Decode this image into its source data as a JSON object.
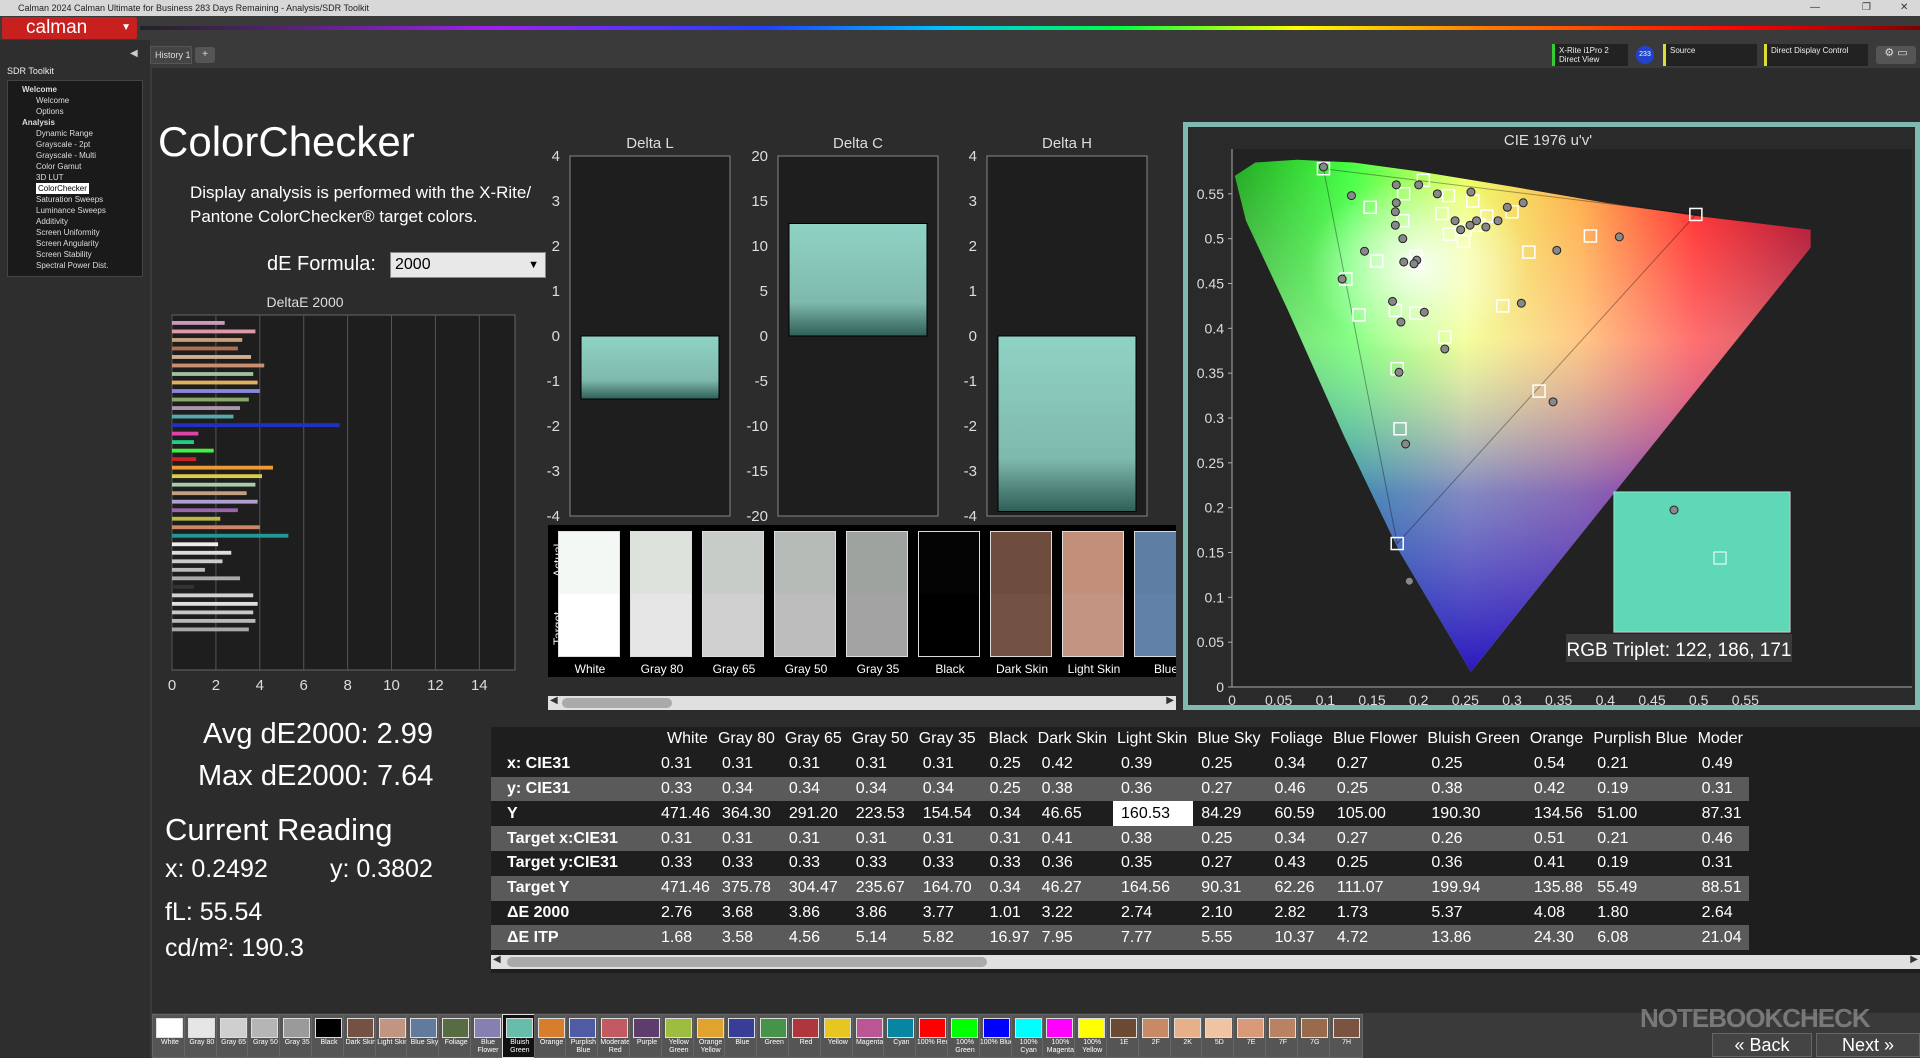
{
  "window": {
    "title": "Calman 2024 Calman Ultimate for Business 283 Days Remaining - Analysis/SDR Toolkit"
  },
  "logo": {
    "text": "calman"
  },
  "sidebar": {
    "title": "SDR Toolkit",
    "items": [
      {
        "label": "Welcome",
        "level": "group"
      },
      {
        "label": "Welcome",
        "level": "item"
      },
      {
        "label": "Options",
        "level": "item"
      },
      {
        "label": "Analysis",
        "level": "group"
      },
      {
        "label": "Dynamic Range",
        "level": "item"
      },
      {
        "label": "Grayscale - 2pt",
        "level": "item"
      },
      {
        "label": "Grayscale - Multi",
        "level": "item"
      },
      {
        "label": "Color Gamut",
        "level": "item"
      },
      {
        "label": "3D LUT",
        "level": "item"
      },
      {
        "label": "ColorChecker",
        "level": "item",
        "selected": true
      },
      {
        "label": "Saturation Sweeps",
        "level": "item"
      },
      {
        "label": "Luminance Sweeps",
        "level": "item"
      },
      {
        "label": "Additivity",
        "level": "item"
      },
      {
        "label": "Screen Uniformity",
        "level": "item"
      },
      {
        "label": "Screen Angularity",
        "level": "item"
      },
      {
        "label": "Screen Stability",
        "level": "item"
      },
      {
        "label": "Spectral Power Dist.",
        "level": "item"
      }
    ]
  },
  "tabs": {
    "history": "History 1",
    "add": "+"
  },
  "devices": {
    "meter_line1": "X-Rite i1Pro 2",
    "meter_line2": "Direct View",
    "meter_badge": "233",
    "source": "Source",
    "display": "Direct Display Control"
  },
  "page": {
    "title": "ColorChecker",
    "description": "Display analysis is performed with the X-Rite/ Pantone ColorChecker® target colors.",
    "de_formula_label": "dE Formula:",
    "de_formula_value": "2000"
  },
  "stats": {
    "avg": "Avg dE2000: 2.99",
    "max": "Max dE2000: 7.64",
    "current_title": "Current Reading",
    "x": "x: 0.2492",
    "y": "y: 0.3802",
    "fl": "fL: 55.54",
    "cdm2": "cd/m²: 190.3"
  },
  "colors": {
    "accent": "#7fb9b0",
    "bar_top": "#8fd3c5",
    "bar_bottom": "#2f5f58",
    "table_alt": "#5a5a5a"
  },
  "chart_data": [
    {
      "type": "bar",
      "title": "DeltaE 2000",
      "orientation": "horizontal",
      "xlim": [
        0,
        15
      ],
      "xticks": [
        "0",
        "2",
        "4",
        "6",
        "8",
        "10",
        "12",
        "14"
      ],
      "values": [
        2.4,
        3.8,
        3.2,
        3.0,
        3.6,
        4.2,
        3.7,
        3.9,
        4.0,
        3.5,
        3.1,
        2.8,
        7.64,
        1.2,
        1.0,
        1.9,
        1.1,
        4.6,
        4.1,
        3.8,
        3.4,
        3.9,
        3.0,
        2.2,
        4.0,
        5.3,
        2.1,
        2.7,
        2.3,
        1.5,
        3.1,
        1.0,
        3.7,
        3.9,
        3.7,
        3.8,
        3.5
      ]
    },
    {
      "type": "bar",
      "title": "Delta L",
      "ylim": [
        -4,
        4
      ],
      "yticks": [
        "4",
        "3",
        "2",
        "1",
        "0",
        "-1",
        "-2",
        "-3",
        "-4"
      ],
      "values": [
        -1.4
      ]
    },
    {
      "type": "bar",
      "title": "Delta C",
      "ylim": [
        -20,
        20
      ],
      "yticks": [
        "20",
        "15",
        "10",
        "5",
        "0",
        "-5",
        "-10",
        "-15",
        "-20"
      ],
      "values": [
        12.5
      ]
    },
    {
      "type": "bar",
      "title": "Delta H",
      "ylim": [
        -4,
        4
      ],
      "yticks": [
        "4",
        "3",
        "2",
        "1",
        "0",
        "-1",
        "-2",
        "-3",
        "-4"
      ],
      "values": [
        -3.9
      ]
    },
    {
      "type": "scatter",
      "title": "CIE 1976 u'v'",
      "xlim": [
        0,
        0.6
      ],
      "ylim": [
        0,
        0.6
      ],
      "xticks": [
        "0",
        "0.05",
        "0.1",
        "0.15",
        "0.2",
        "0.25",
        "0.3",
        "0.35",
        "0.4",
        "0.45",
        "0.5",
        "0.55"
      ],
      "yticks": [
        "0",
        "0.05",
        "0.1",
        "0.15",
        "0.2",
        "0.25",
        "0.3",
        "0.35",
        "0.4",
        "0.45",
        "0.5",
        "0.55"
      ],
      "targets": [
        [
          0.098,
          0.578
        ],
        [
          0.205,
          0.565
        ],
        [
          0.232,
          0.548
        ],
        [
          0.258,
          0.542
        ],
        [
          0.184,
          0.55
        ],
        [
          0.148,
          0.535
        ],
        [
          0.183,
          0.52
        ],
        [
          0.155,
          0.475
        ],
        [
          0.122,
          0.455
        ],
        [
          0.136,
          0.415
        ],
        [
          0.175,
          0.42
        ],
        [
          0.197,
          0.417
        ],
        [
          0.197,
          0.48
        ],
        [
          0.198,
          0.473
        ],
        [
          0.225,
          0.528
        ],
        [
          0.233,
          0.505
        ],
        [
          0.248,
          0.497
        ],
        [
          0.25,
          0.51
        ],
        [
          0.265,
          0.515
        ],
        [
          0.273,
          0.525
        ],
        [
          0.3,
          0.53
        ],
        [
          0.318,
          0.485
        ],
        [
          0.384,
          0.503
        ],
        [
          0.497,
          0.527
        ],
        [
          0.29,
          0.425
        ],
        [
          0.228,
          0.39
        ],
        [
          0.177,
          0.355
        ],
        [
          0.329,
          0.33
        ],
        [
          0.18,
          0.288
        ],
        [
          0.177,
          0.16
        ]
      ],
      "actuals": [
        [
          0.098,
          0.58
        ],
        [
          0.128,
          0.548
        ],
        [
          0.176,
          0.56
        ],
        [
          0.176,
          0.54
        ],
        [
          0.175,
          0.53
        ],
        [
          0.22,
          0.55
        ],
        [
          0.2,
          0.56
        ],
        [
          0.256,
          0.552
        ],
        [
          0.175,
          0.515
        ],
        [
          0.198,
          0.476
        ],
        [
          0.142,
          0.486
        ],
        [
          0.118,
          0.455
        ],
        [
          0.183,
          0.5
        ],
        [
          0.195,
          0.472
        ],
        [
          0.239,
          0.52
        ],
        [
          0.245,
          0.51
        ],
        [
          0.255,
          0.515
        ],
        [
          0.262,
          0.52
        ],
        [
          0.272,
          0.513
        ],
        [
          0.285,
          0.52
        ],
        [
          0.295,
          0.535
        ],
        [
          0.312,
          0.54
        ],
        [
          0.348,
          0.487
        ],
        [
          0.415,
          0.502
        ],
        [
          0.31,
          0.428
        ],
        [
          0.228,
          0.377
        ],
        [
          0.179,
          0.351
        ],
        [
          0.344,
          0.318
        ],
        [
          0.186,
          0.271
        ],
        [
          0.19,
          0.118
        ],
        [
          0.172,
          0.43
        ],
        [
          0.181,
          0.407
        ],
        [
          0.206,
          0.418
        ],
        [
          0.184,
          0.474
        ]
      ],
      "inset_label": "RGB Triplet: 122, 186, 171"
    }
  ],
  "swatches": {
    "actual_label": "Actual",
    "target_label": "Target",
    "items": [
      {
        "name": "White",
        "actual": "#f4f8f4",
        "target": "#ffffff"
      },
      {
        "name": "Gray 80",
        "actual": "#dde2dd",
        "target": "#e6e6e6"
      },
      {
        "name": "Gray 65",
        "actual": "#c8ccc8",
        "target": "#d0d0d0"
      },
      {
        "name": "Gray 50",
        "actual": "#b7bbb7",
        "target": "#bdbdbd"
      },
      {
        "name": "Gray 35",
        "actual": "#9fa3a0",
        "target": "#a3a3a3"
      },
      {
        "name": "Black",
        "actual": "#040404",
        "target": "#000000"
      },
      {
        "name": "Dark Skin",
        "actual": "#6e4c3e",
        "target": "#735244"
      },
      {
        "name": "Light Skin",
        "actual": "#c2907a",
        "target": "#c49482"
      },
      {
        "name": "Blue",
        "actual": "#5e7fa3",
        "target": "#6281a8"
      }
    ]
  },
  "table": {
    "columns": [
      "White",
      "Gray 80",
      "Gray 65",
      "Gray 50",
      "Gray 35",
      "Black",
      "Dark Skin",
      "Light Skin",
      "Blue Sky",
      "Foliage",
      "Blue Flower",
      "Bluish Green",
      "Orange",
      "Purplish Blue",
      "Moder"
    ],
    "rows": [
      {
        "label": "x: CIE31",
        "values": [
          "0.31",
          "0.31",
          "0.31",
          "0.31",
          "0.31",
          "0.25",
          "0.42",
          "0.39",
          "0.25",
          "0.34",
          "0.27",
          "0.25",
          "0.54",
          "0.21",
          "0.49"
        ]
      },
      {
        "label": "y: CIE31",
        "values": [
          "0.33",
          "0.34",
          "0.34",
          "0.34",
          "0.34",
          "0.25",
          "0.38",
          "0.36",
          "0.27",
          "0.46",
          "0.25",
          "0.38",
          "0.42",
          "0.19",
          "0.31"
        ]
      },
      {
        "label": "Y",
        "values": [
          "471.46",
          "364.30",
          "291.20",
          "223.53",
          "154.54",
          "0.34",
          "46.65",
          "160.53",
          "84.29",
          "60.59",
          "105.00",
          "190.30",
          "134.56",
          "51.00",
          "87.31"
        ]
      },
      {
        "label": "Target x:CIE31",
        "values": [
          "0.31",
          "0.31",
          "0.31",
          "0.31",
          "0.31",
          "0.31",
          "0.41",
          "0.38",
          "0.25",
          "0.34",
          "0.27",
          "0.26",
          "0.51",
          "0.21",
          "0.46"
        ]
      },
      {
        "label": "Target y:CIE31",
        "values": [
          "0.33",
          "0.33",
          "0.33",
          "0.33",
          "0.33",
          "0.33",
          "0.36",
          "0.35",
          "0.27",
          "0.43",
          "0.25",
          "0.36",
          "0.41",
          "0.19",
          "0.31"
        ]
      },
      {
        "label": "Target Y",
        "values": [
          "471.46",
          "375.78",
          "304.47",
          "235.67",
          "164.70",
          "0.34",
          "46.27",
          "164.56",
          "90.31",
          "62.26",
          "111.07",
          "199.94",
          "135.88",
          "55.49",
          "88.51"
        ]
      },
      {
        "label": "ΔE 2000",
        "values": [
          "2.76",
          "3.68",
          "3.86",
          "3.86",
          "3.77",
          "1.01",
          "3.22",
          "2.74",
          "2.10",
          "2.82",
          "1.73",
          "5.37",
          "4.08",
          "1.80",
          "2.64"
        ]
      },
      {
        "label": "ΔE ITP",
        "values": [
          "1.68",
          "3.58",
          "4.56",
          "5.14",
          "5.82",
          "16.97",
          "7.95",
          "7.77",
          "5.55",
          "10.37",
          "4.72",
          "13.86",
          "24.30",
          "6.08",
          "21.04"
        ]
      }
    ]
  },
  "bottom_swatches": [
    {
      "label": "White",
      "color": "#ffffff"
    },
    {
      "label": "Gray 80",
      "color": "#e6e6e6"
    },
    {
      "label": "Gray 65",
      "color": "#cfcfcf"
    },
    {
      "label": "Gray 50",
      "color": "#b5b5b5"
    },
    {
      "label": "Gray 35",
      "color": "#9a9a9a"
    },
    {
      "label": "Black",
      "color": "#000000"
    },
    {
      "label": "Dark Skin",
      "color": "#735244"
    },
    {
      "label": "Light Skin",
      "color": "#c29482"
    },
    {
      "label": "Blue Sky",
      "color": "#627a9d"
    },
    {
      "label": "Foliage",
      "color": "#576c43"
    },
    {
      "label": "Blue Flower",
      "color": "#8580b1"
    },
    {
      "label": "Bluish Green",
      "color": "#67bdaa"
    },
    {
      "label": "Orange",
      "color": "#d67e2c"
    },
    {
      "label": "Purplish Blue",
      "color": "#505ba6"
    },
    {
      "label": "Moderate Red",
      "color": "#c15a63"
    },
    {
      "label": "Purple",
      "color": "#5e3c6c"
    },
    {
      "label": "Yellow Green",
      "color": "#9dbc40"
    },
    {
      "label": "Orange Yellow",
      "color": "#e0a32e"
    },
    {
      "label": "Blue",
      "color": "#383d96"
    },
    {
      "label": "Green",
      "color": "#469449"
    },
    {
      "label": "Red",
      "color": "#af363c"
    },
    {
      "label": "Yellow",
      "color": "#e7c71f"
    },
    {
      "label": "Magenta",
      "color": "#bb5695"
    },
    {
      "label": "Cyan",
      "color": "#0885a1"
    },
    {
      "label": "100% Red",
      "color": "#ff0000"
    },
    {
      "label": "100% Green",
      "color": "#00ff00"
    },
    {
      "label": "100% Blue",
      "color": "#0000ff"
    },
    {
      "label": "100% Cyan",
      "color": "#00ffff"
    },
    {
      "label": "100% Magenta",
      "color": "#ff00ff"
    },
    {
      "label": "100% Yellow",
      "color": "#ffff00"
    },
    {
      "label": "1E",
      "color": "#6b4a34"
    },
    {
      "label": "2F",
      "color": "#c88a66"
    },
    {
      "label": "2K",
      "color": "#e6b08a"
    },
    {
      "label": "5D",
      "color": "#f0c3a2"
    },
    {
      "label": "7E",
      "color": "#d89a78"
    },
    {
      "label": "7F",
      "color": "#b98262"
    },
    {
      "label": "7G",
      "color": "#9a6a4c"
    },
    {
      "label": "7H",
      "color": "#7a5440"
    }
  ],
  "nav_buttons": {
    "back": "Back",
    "next": "Next"
  },
  "watermark": "NOTEBOOKCHECK"
}
